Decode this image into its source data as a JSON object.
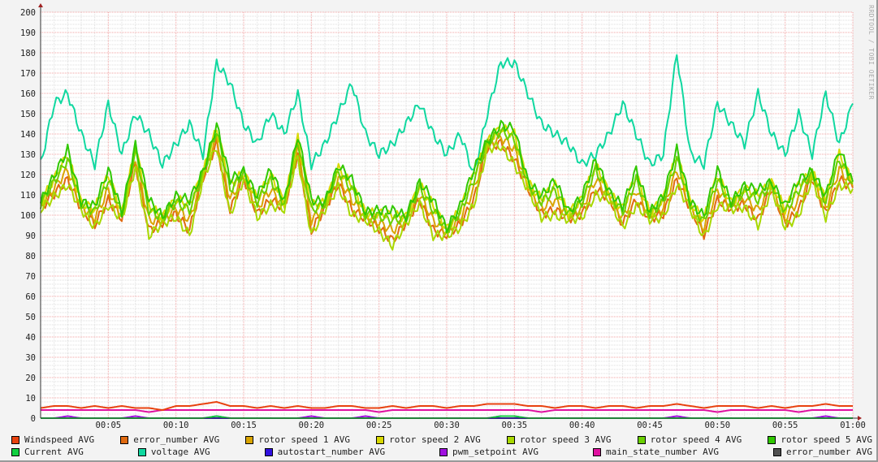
{
  "watermark": "RRDTOOL / TOBI OETIKER",
  "chart_data": {
    "type": "line",
    "title": "",
    "xlabel": "",
    "ylabel": "",
    "ylim": [
      0,
      200
    ],
    "xlim_minutes": [
      0,
      60
    ],
    "y_ticks": [
      "0",
      "10",
      "20",
      "30",
      "40",
      "50",
      "60",
      "70",
      "80",
      "90",
      "100",
      "110",
      "120",
      "130",
      "140",
      "150",
      "160",
      "170",
      "180",
      "190",
      "200"
    ],
    "x_ticks": [
      {
        "label": "00:05",
        "min": 5
      },
      {
        "label": "00:10",
        "min": 10
      },
      {
        "label": "00:15",
        "min": 15
      },
      {
        "label": "00:20",
        "min": 20
      },
      {
        "label": "00:25",
        "min": 25
      },
      {
        "label": "00:30",
        "min": 30
      },
      {
        "label": "00:35",
        "min": 35
      },
      {
        "label": "00:40",
        "min": 40
      },
      {
        "label": "00:45",
        "min": 45
      },
      {
        "label": "00:50",
        "min": 50
      },
      {
        "label": "00:55",
        "min": 55
      },
      {
        "label": "01:00",
        "min": 60
      }
    ],
    "grid": true,
    "rotor_base_values": [
      105,
      115,
      125,
      105,
      100,
      115,
      100,
      130,
      100,
      98,
      105,
      100,
      120,
      140,
      110,
      120,
      105,
      115,
      105,
      135,
      100,
      105,
      120,
      110,
      100,
      98,
      95,
      98,
      112,
      100,
      92,
      100,
      115,
      135,
      140,
      135,
      115,
      105,
      110,
      100,
      105,
      120,
      110,
      100,
      115,
      100,
      105,
      125,
      105,
      95,
      115,
      105,
      110,
      105,
      115,
      100,
      110,
      120,
      105,
      125,
      115
    ],
    "series": [
      {
        "name": "Windspeed AVG",
        "color": "#e8420f",
        "values": [
          5,
          6,
          6,
          5,
          6,
          5,
          6,
          5,
          5,
          4,
          6,
          6,
          7,
          8,
          6,
          6,
          5,
          6,
          5,
          6,
          5,
          5,
          6,
          6,
          5,
          5,
          6,
          5,
          6,
          6,
          5,
          6,
          6,
          7,
          7,
          7,
          6,
          6,
          5,
          6,
          6,
          5,
          6,
          6,
          5,
          6,
          6,
          7,
          6,
          5,
          6,
          6,
          6,
          5,
          6,
          5,
          6,
          6,
          7,
          6,
          6
        ]
      },
      {
        "name": "error_number AVG",
        "color": "#e06a10",
        "rotor_offset": -3
      },
      {
        "name": "rotor speed 1 AVG",
        "color": "#d9a400",
        "rotor_offset": -1
      },
      {
        "name": "rotor speed 2 AVG",
        "color": "#d8d800",
        "rotor_offset": 2
      },
      {
        "name": "rotor speed 3 AVG",
        "color": "#a8d800",
        "rotor_offset": -4
      },
      {
        "name": "rotor speed 4 AVG",
        "color": "#6ad000",
        "rotor_offset": 1
      },
      {
        "name": "rotor speed 5 AVG",
        "color": "#30c800",
        "rotor_offset": 3
      },
      {
        "name": "Current AVG",
        "color": "#10d040",
        "values": [
          0,
          0,
          0,
          0,
          0,
          0,
          0,
          0,
          0,
          0,
          0,
          0,
          0,
          1,
          0,
          0,
          0,
          0,
          0,
          0,
          0,
          0,
          0,
          0,
          0,
          0,
          0,
          0,
          0,
          0,
          0,
          0,
          0,
          0,
          1,
          1,
          0,
          0,
          0,
          0,
          0,
          0,
          0,
          0,
          0,
          0,
          0,
          0,
          0,
          0,
          0,
          0,
          0,
          0,
          0,
          0,
          0,
          0,
          0,
          0,
          0
        ]
      },
      {
        "name": "voltage AVG",
        "color": "#10d8a0",
        "values": [
          125,
          155,
          160,
          140,
          125,
          155,
          130,
          150,
          140,
          125,
          135,
          145,
          130,
          175,
          165,
          145,
          135,
          150,
          140,
          160,
          125,
          135,
          150,
          165,
          140,
          130,
          135,
          145,
          155,
          140,
          130,
          140,
          120,
          150,
          175,
          175,
          160,
          145,
          140,
          135,
          125,
          130,
          140,
          155,
          140,
          125,
          130,
          180,
          130,
          125,
          155,
          145,
          135,
          160,
          140,
          130,
          150,
          130,
          160,
          135,
          155
        ]
      },
      {
        "name": "autostart_number AVG",
        "color": "#3010e0",
        "values": [
          0,
          0,
          0,
          0,
          0,
          0,
          0,
          0,
          0,
          0,
          0,
          0,
          0,
          0,
          0,
          0,
          0,
          0,
          0,
          0,
          0,
          0,
          0,
          0,
          0,
          0,
          0,
          0,
          0,
          0,
          0,
          0,
          0,
          0,
          0,
          0,
          0,
          0,
          0,
          0,
          0,
          0,
          0,
          0,
          0,
          0,
          0,
          0,
          0,
          0,
          0,
          0,
          0,
          0,
          0,
          0,
          0,
          0,
          0,
          0,
          0
        ]
      },
      {
        "name": "pwm_setpoint AVG",
        "color": "#a010e0",
        "values": [
          0,
          0,
          1,
          0,
          0,
          0,
          0,
          1,
          0,
          0,
          0,
          0,
          0,
          1,
          0,
          0,
          0,
          0,
          0,
          0,
          1,
          0,
          0,
          0,
          1,
          0,
          0,
          0,
          0,
          0,
          0,
          0,
          0,
          0,
          1,
          1,
          0,
          0,
          0,
          0,
          0,
          0,
          0,
          0,
          0,
          0,
          0,
          1,
          0,
          0,
          0,
          0,
          0,
          0,
          0,
          0,
          0,
          0,
          1,
          0,
          0
        ]
      },
      {
        "name": "main_state_number AVG",
        "color": "#e010a0",
        "values": [
          4,
          4,
          4,
          4,
          4,
          4,
          4,
          4,
          3,
          4,
          4,
          4,
          4,
          4,
          4,
          4,
          4,
          4,
          4,
          4,
          4,
          4,
          4,
          4,
          4,
          3,
          4,
          4,
          4,
          4,
          4,
          4,
          4,
          4,
          4,
          4,
          4,
          3,
          4,
          4,
          4,
          4,
          4,
          4,
          4,
          4,
          4,
          4,
          4,
          4,
          3,
          4,
          4,
          4,
          4,
          4,
          3,
          4,
          4,
          4,
          4
        ]
      },
      {
        "name": "error_number AVG",
        "color": "#505050",
        "values": [
          0,
          0,
          0,
          0,
          0,
          0,
          0,
          0,
          0,
          0,
          0,
          0,
          0,
          0,
          0,
          0,
          0,
          0,
          0,
          0,
          0,
          0,
          0,
          0,
          0,
          0,
          0,
          0,
          0,
          0,
          0,
          0,
          0,
          0,
          0,
          0,
          0,
          0,
          0,
          0,
          0,
          0,
          0,
          0,
          0,
          0,
          0,
          0,
          0,
          0,
          0,
          0,
          0,
          0,
          0,
          0,
          0,
          0,
          0,
          0,
          0
        ]
      }
    ],
    "legend_position": "bottom"
  }
}
